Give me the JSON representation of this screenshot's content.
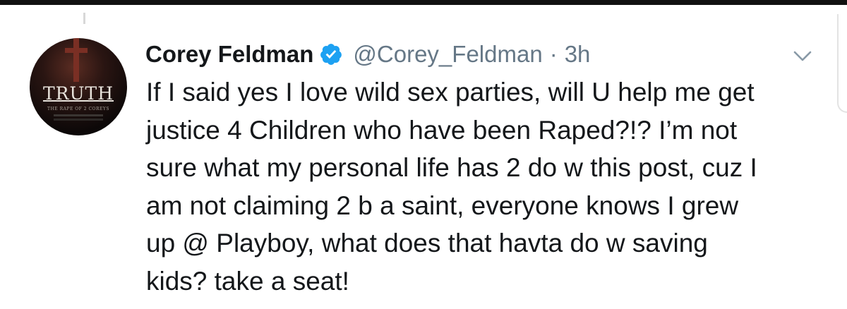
{
  "tweet": {
    "author_name": "Corey Feldman",
    "handle": "@Corey_Feldman",
    "separator": "·",
    "time": "3h",
    "text_lines": [
      "If I said yes I love wild sex parties, will U help me get",
      "justice 4 Children who have been Raped?!? I’m not",
      "sure what my personal life has 2 do w this post, cuz I",
      "am not claiming 2 b a saint, everyone knows I grew",
      "up @ Playboy, what does that havta do w saving",
      "kids? take a seat!"
    ]
  },
  "avatar": {
    "title": "TRUTH",
    "subtitle": "THE RAPE OF 2 COREYS"
  },
  "icons": {
    "verified": "verified-badge-icon",
    "menu": "chevron-down-icon"
  },
  "colors": {
    "text": "#14171a",
    "secondary": "#657786",
    "verified": "#1da1f2",
    "background": "#ffffff"
  }
}
